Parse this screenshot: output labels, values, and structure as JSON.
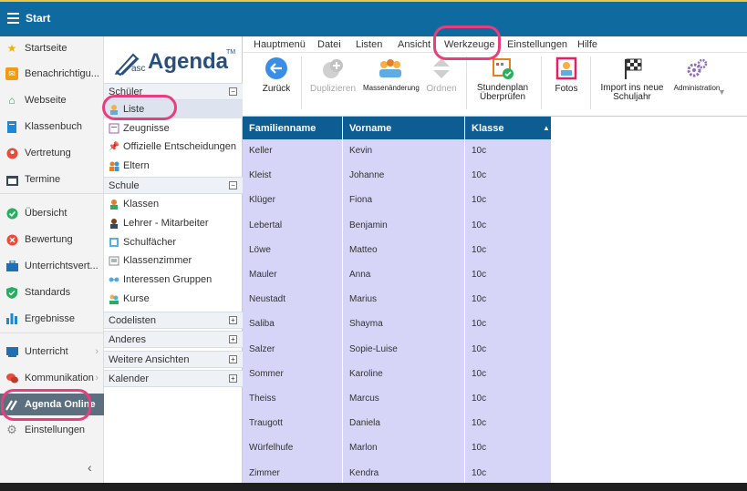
{
  "topbar": {
    "title": "Start"
  },
  "leftnav": {
    "items": [
      {
        "label": "Startseite",
        "icon": "star-icon"
      },
      {
        "label": "Benachrichtigu...",
        "icon": "envelope-icon"
      },
      {
        "label": "Webseite",
        "icon": "house-icon"
      },
      {
        "label": "Klassenbuch",
        "icon": "book-icon"
      },
      {
        "label": "Vertretung",
        "icon": "person-swap-icon"
      },
      {
        "label": "Termine",
        "icon": "calendar-icon"
      },
      {
        "label": "Übersicht",
        "icon": "check-circle-icon"
      },
      {
        "label": "Bewertung",
        "icon": "grade-icon"
      },
      {
        "label": "Unterrichtsvert...",
        "icon": "briefcase-icon"
      },
      {
        "label": "Standards",
        "icon": "shield-check-icon"
      },
      {
        "label": "Ergebnisse",
        "icon": "bar-chart-icon"
      },
      {
        "label": "Unterricht",
        "icon": "board-icon"
      },
      {
        "label": "Kommunikation",
        "icon": "chat-icon"
      },
      {
        "label": "Agenda Online",
        "icon": "agenda-logo-icon"
      },
      {
        "label": "Einstellungen",
        "icon": "gear-icon"
      }
    ],
    "collapse": "‹"
  },
  "sidepanel": {
    "logo": {
      "asc": "asc",
      "agenda": "Agenda",
      "tm": "TM"
    },
    "schueler": {
      "header": "Schüler",
      "toggle": "−",
      "items": [
        {
          "label": "Liste"
        },
        {
          "label": "Zeugnisse"
        },
        {
          "label": "Offizielle Entscheidungen"
        },
        {
          "label": "Eltern"
        }
      ]
    },
    "schule": {
      "header": "Schule",
      "toggle": "−",
      "items": [
        {
          "label": "Klassen"
        },
        {
          "label": "Lehrer - Mitarbeiter"
        },
        {
          "label": "Schulfächer"
        },
        {
          "label": "Klassenzimmer"
        },
        {
          "label": "Interessen Gruppen"
        },
        {
          "label": "Kurse"
        }
      ]
    },
    "collapsed": [
      {
        "label": "Codelisten",
        "toggle": "+"
      },
      {
        "label": "Anderes",
        "toggle": "+"
      },
      {
        "label": "Weitere Ansichten",
        "toggle": "+"
      },
      {
        "label": "Kalender",
        "toggle": "+"
      }
    ]
  },
  "menubar": {
    "items": [
      "Hauptmenü",
      "Datei",
      "Listen",
      "Ansicht",
      "Werkzeuge",
      "Einstellungen",
      "Hilfe"
    ]
  },
  "toolbar": {
    "zurueck": "Zurück",
    "duplizieren": "Duplizieren",
    "massenaenderung": "Massenänderung",
    "ordnen": "Ordnen",
    "stundenplan_line1": "Stundenplan",
    "stundenplan_line2": "Überprüfen",
    "fotos": "Fotos",
    "import_line1": "Import ins neue",
    "import_line2": "Schuljahr",
    "administration": "Administration",
    "more": "▼"
  },
  "grid": {
    "columns": [
      "Familienname",
      "Vorname",
      "Klasse"
    ],
    "sort_indicator": "▲",
    "rows": [
      [
        "Keller",
        "Kevin",
        "10c"
      ],
      [
        "Kleist",
        "Johanne",
        "10c"
      ],
      [
        "Klüger",
        "Fiona",
        "10c"
      ],
      [
        "Lebertal",
        "Benjamin",
        "10c"
      ],
      [
        "Löwe",
        "Matteo",
        "10c"
      ],
      [
        "Mauler",
        "Anna",
        "10c"
      ],
      [
        "Neustadt",
        "Marius",
        "10c"
      ],
      [
        "Saliba",
        "Shayma",
        "10c"
      ],
      [
        "Salzer",
        "Sopie-Luise",
        "10c"
      ],
      [
        "Sommer",
        "Karoline",
        "10c"
      ],
      [
        "Theiss",
        "Marcus",
        "10c"
      ],
      [
        "Traugott",
        "Daniela",
        "10c"
      ],
      [
        "Würfelhufe",
        "Marlon",
        "10c"
      ],
      [
        "Zimmer",
        "Kendra",
        "10c"
      ]
    ]
  },
  "colors": {
    "topbar": "#0f6aa0",
    "grid_header": "#0e5d92",
    "grid_rows": "#d6d5f7",
    "highlight": "#ea3d7c",
    "active_nav": "#5b6f7e"
  }
}
